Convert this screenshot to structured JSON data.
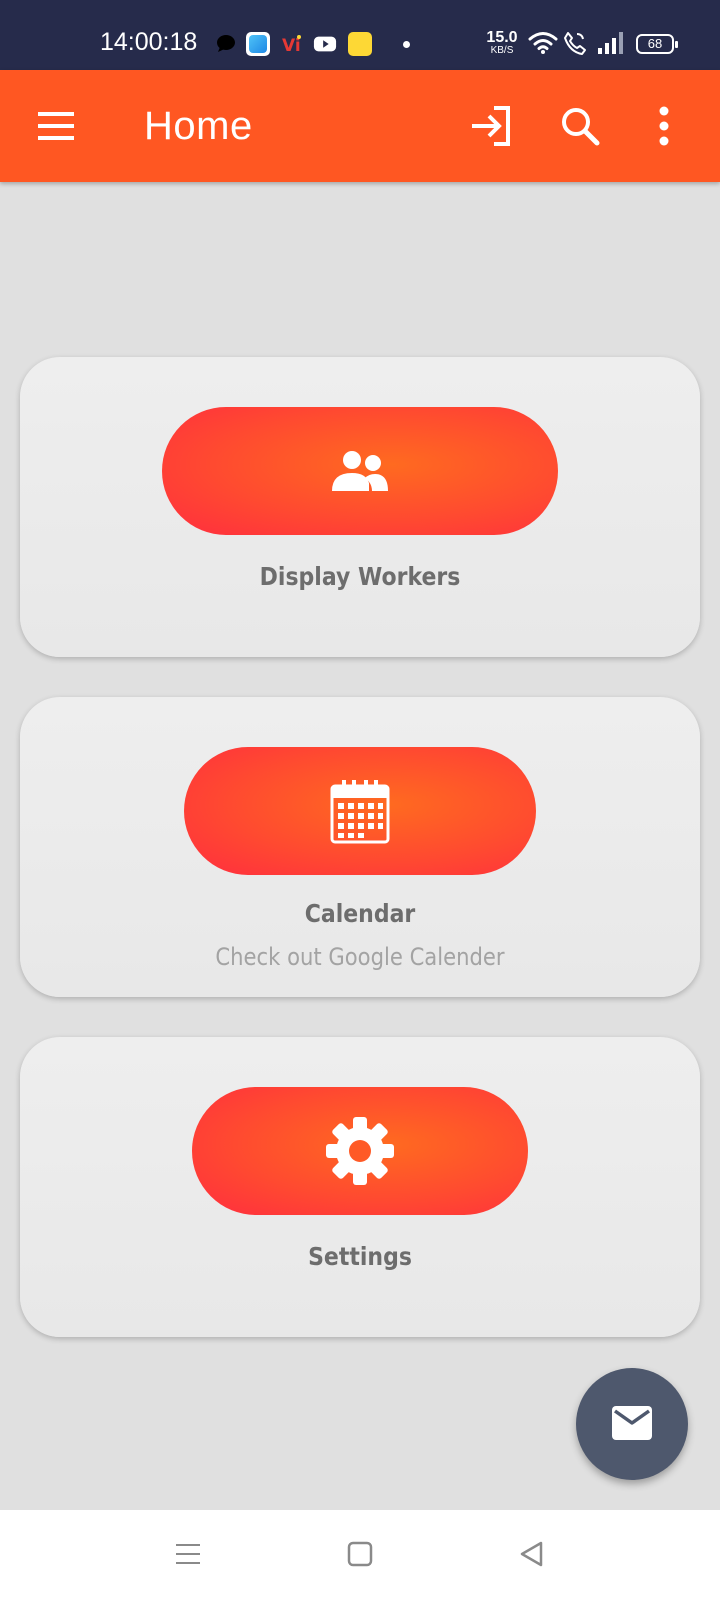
{
  "status_bar": {
    "time": "14:00:18",
    "net_speed_value": "15.0",
    "net_speed_unit": "KB/S",
    "battery": "68",
    "notification_icons": [
      "chat-icon",
      "app-icon",
      "vi-icon",
      "youtube-icon",
      "app-icon-yellow"
    ]
  },
  "app_bar": {
    "title": "Home",
    "icons": [
      "menu-icon",
      "login-icon",
      "search-icon",
      "more-vert-icon"
    ]
  },
  "cards": [
    {
      "label": "Display Workers",
      "subtitle": "",
      "icon": "people-icon"
    },
    {
      "label": "Calendar",
      "subtitle": "Check out Google Calender",
      "icon": "calendar-icon"
    },
    {
      "label": "Settings",
      "subtitle": "",
      "icon": "gear-icon"
    }
  ],
  "fab": {
    "icon": "mail-icon"
  },
  "nav_bar": {
    "icons": [
      "recents-icon",
      "home-icon",
      "back-icon"
    ]
  },
  "colors": {
    "status_bar": "#262b4b",
    "app_bar": "#ff5722",
    "pill_start": "#ff2d3f",
    "pill_mid": "#ff6a20",
    "fab": "#4e586d",
    "background": "#e0e0e0"
  }
}
